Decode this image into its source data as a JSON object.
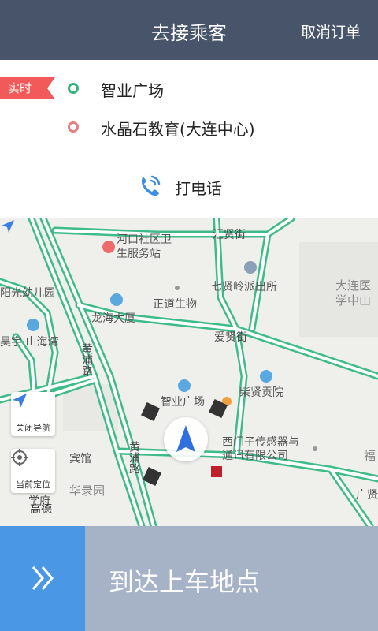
{
  "header": {
    "title": "去接乘客",
    "cancel_label": "取消订单",
    "bg_color": "#475469"
  },
  "route": {
    "badge": "实时",
    "start": "智业广场",
    "end": "水晶石教育(大连中心)",
    "start_dot_color": "#35b57e",
    "end_dot_color": "#e87f7f"
  },
  "call": {
    "label": "打电话",
    "icon": "phone-icon"
  },
  "map": {
    "labels": {
      "clinic": "河口社区卫\n生服务站",
      "huixian": "汇贤街",
      "qixian_police": "七贤岭派出所",
      "hospital": "大连医\n学中山",
      "kindergarten": "阳光幼儿园",
      "zhengdao": "正道生物",
      "longhai": "龙海大厦",
      "haoyu": "昊宇·山海湾",
      "aixian": "爱贤街",
      "huangpu1": "黄浦路",
      "zhiye_square": "智业广场",
      "chaixian": "柴贤贡院",
      "siemens": "西门子传感器与\n通讯有限公司",
      "hotel": "宾馆",
      "hualu": "华录园",
      "xuefu": "学府",
      "huangpu2": "黄浦路",
      "fu": "福",
      "guangxian": "广贤路"
    },
    "nav_control": {
      "label": "关闭导航",
      "icon": "navigation-arrow-icon"
    },
    "locate_control": {
      "label": "当前定位",
      "icon": "crosshair-icon"
    },
    "brand": "高德",
    "road_color": "#3dbb88"
  },
  "bottom": {
    "label": "到达上车地点",
    "slide_color": "#4a97e6",
    "icon": "double-chevron-right-icon"
  }
}
